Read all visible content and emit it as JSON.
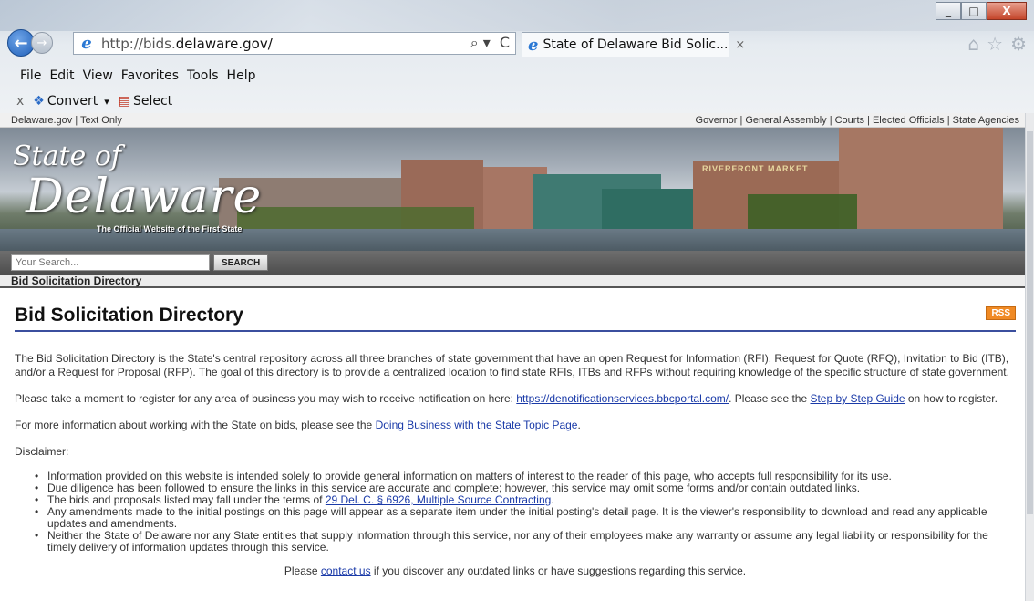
{
  "browser": {
    "address": "http://bids.",
    "address_domain": "delaware.gov/",
    "tab_title": "State of Delaware Bid Solic...",
    "tab_close": "×",
    "min_label": "_",
    "max_label": "□",
    "close_label": "X",
    "back_label": "←",
    "forward_label": "→",
    "search_glyph": "⌕ ▾",
    "refresh_glyph": "C",
    "home_glyph": "⌂",
    "fav_glyph": "☆",
    "gear_glyph": "⚙",
    "menu": [
      "File",
      "Edit",
      "View",
      "Favorites",
      "Tools",
      "Help"
    ],
    "cmd": {
      "x": "x",
      "convert": "Convert",
      "convert_arrow": "▾",
      "select": "Select"
    }
  },
  "site": {
    "top_left": "Delaware.gov  |  Text Only",
    "top_right": "Governor | General Assembly | Courts | Elected Officials | State Agencies",
    "logo_state": "State of",
    "logo_delaware": "Delaware",
    "logo_tagline": "The Official Website of the First State",
    "market_sign": "RIVERFRONT MARKET",
    "search_placeholder": "Your Search...",
    "search_button": "SEARCH",
    "breadcrumb": "Bid Solicitation Directory"
  },
  "content": {
    "title": "Bid Solicitation Directory",
    "rss": "RSS",
    "intro": "The Bid Solicitation Directory is the State's central repository across all three branches of state government that have an open Request for Information (RFI), Request for Quote (RFQ), Invitation to Bid (ITB), and/or a Request for Proposal (RFP). The goal of this directory is to provide a centralized location to find state RFIs, ITBs and RFPs without requiring knowledge of the specific structure of state government.",
    "register_pre": "Please take a moment to register for any area of business you may wish to receive notification on here: ",
    "register_link": "https://denotificationservices.bbcportal.com/",
    "register_mid": ". Please see the ",
    "guide_link": "Step by Step Guide",
    "register_post": " on how to register.",
    "more_pre": "For more information about working with the State on bids, please see the ",
    "more_link": "Doing Business with the State Topic Page",
    "more_post": ".",
    "disclaimer_label": "Disclaimer:",
    "disc1": "Information provided on this website is intended solely to provide general information on matters of interest to the reader of this page, who accepts full responsibility for its use.",
    "disc2": "Due diligence has been followed to ensure the links in this service are accurate and complete; however, this service may omit some forms and/or contain outdated links.",
    "disc3_pre": "The bids and proposals listed may fall under the terms of ",
    "disc3_link": "29 Del. C. § 6926, Multiple Source Contracting",
    "disc3_post": ".",
    "disc4": "Any amendments made to the initial postings on this page will appear as a separate item under the initial posting's detail page. It is the viewer's responsibility to download and read any applicable updates and amendments.",
    "disc5": "Neither the State of Delaware nor any State entities that supply information through this service, nor any of their employees make any warranty or assume any legal liability or responsibility for the timely delivery of information updates through this service.",
    "footer_pre": "Please ",
    "footer_link": "contact us",
    "footer_post": " if you discover any outdated links or have suggestions regarding this service."
  }
}
